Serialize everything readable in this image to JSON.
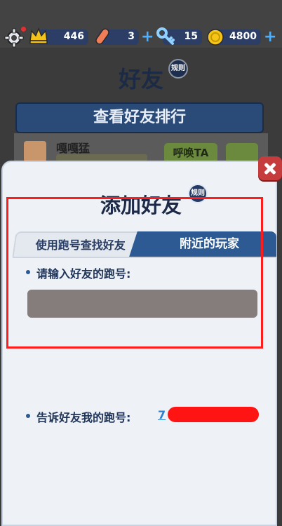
{
  "topbar": {
    "crowns": "446",
    "boards": "3",
    "keys": "15",
    "coins": "4800"
  },
  "background": {
    "title": "好友",
    "rules_badge": "规则",
    "rank_button": "查看好友排行",
    "friend_name": "嘎嘎猛",
    "call_button": "呼唤TA"
  },
  "dialog": {
    "title": "添加好友",
    "rules_badge": "规则",
    "tab_search": "使用跑号查找好友",
    "tab_nearby": "附近的玩家",
    "input_label": "请输入好友的跑号:",
    "input_value": "",
    "tell_label": "告诉好友我的跑号:",
    "my_id_visible": "7"
  },
  "colors": {
    "tab_active": "#2d5a92",
    "highlight": "#ff1c1c",
    "input_bg": "#847d7c",
    "close": "#c63b3b"
  }
}
